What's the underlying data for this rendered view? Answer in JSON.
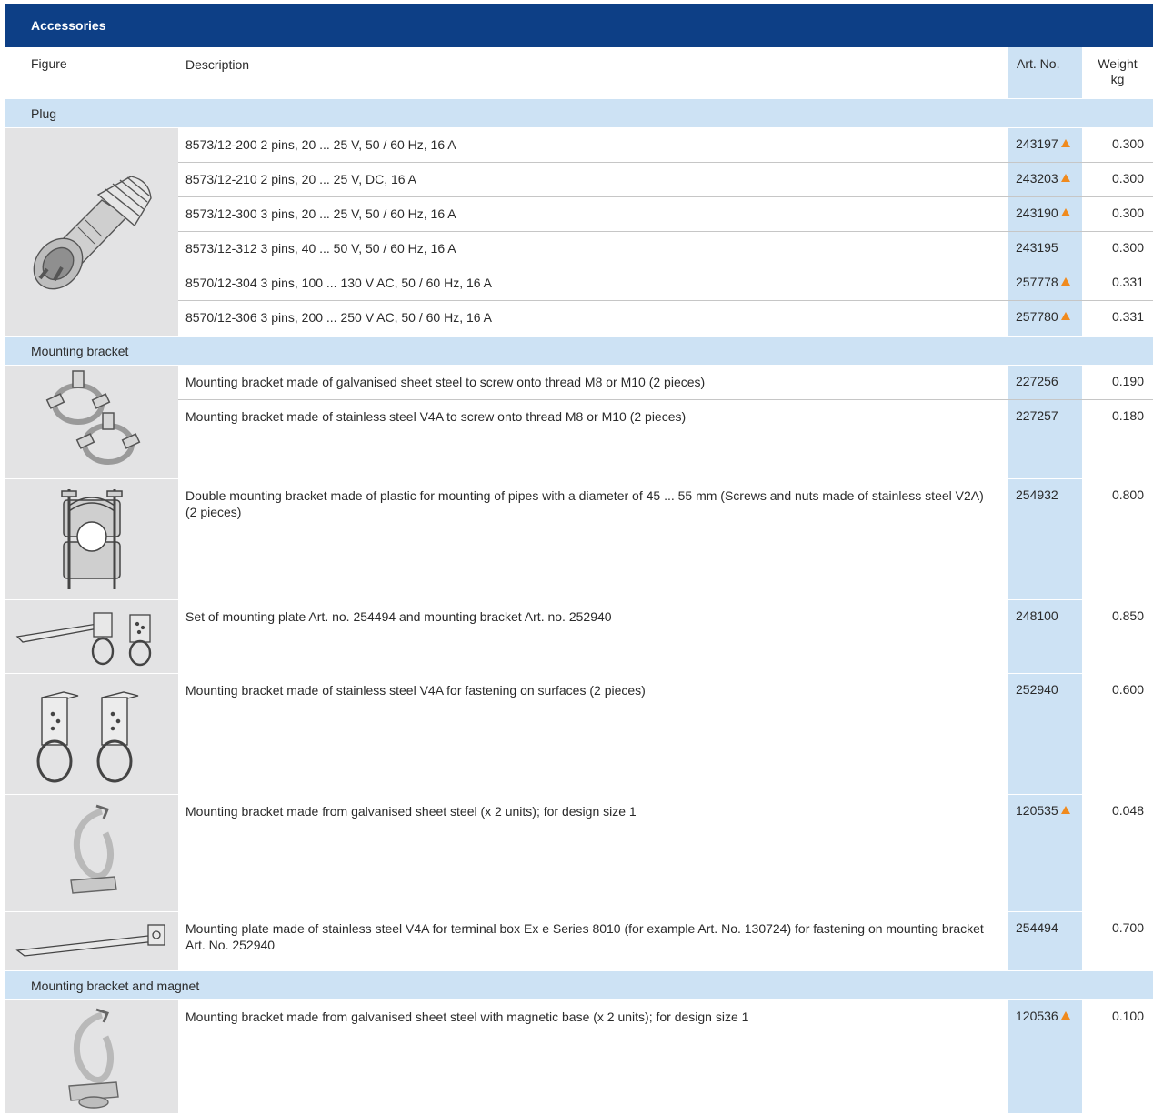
{
  "title": "Accessories",
  "columns": {
    "figure": "Figure",
    "description": "Description",
    "art_no": "Art. No.",
    "weight_line1": "Weight",
    "weight_line2": "kg"
  },
  "colors": {
    "header_bg": "#0d3f86",
    "category_bg": "#cde2f4",
    "figure_bg": "#e3e3e4",
    "art_col_bg": "#cde2f4",
    "marker": "#f08a1d"
  },
  "categories": [
    {
      "name": "Plug",
      "groups": [
        {
          "figure_icon": "plug-icon",
          "items": [
            {
              "desc": "8573/12-200 2 pins, 20 ... 25 V, 50 / 60 Hz, 16 A",
              "art": "243197",
              "marked": true,
              "weight": "0.300"
            },
            {
              "desc": "8573/12-210 2 pins, 20 ... 25 V, DC, 16 A",
              "art": "243203",
              "marked": true,
              "weight": "0.300"
            },
            {
              "desc": "8573/12-300 3 pins, 20 ... 25 V, 50 / 60 Hz, 16 A",
              "art": "243190",
              "marked": true,
              "weight": "0.300"
            },
            {
              "desc": "8573/12-312 3 pins, 40 ... 50 V, 50 / 60 Hz, 16 A",
              "art": "243195",
              "marked": false,
              "weight": "0.300"
            },
            {
              "desc": "8570/12-304 3 pins, 100 ... 130 V AC, 50 / 60 Hz, 16 A",
              "art": "257778",
              "marked": true,
              "weight": "0.331"
            },
            {
              "desc": "8570/12-306 3 pins, 200 ... 250 V AC, 50 / 60 Hz, 16 A",
              "art": "257780",
              "marked": true,
              "weight": "0.331"
            }
          ]
        }
      ]
    },
    {
      "name": "Mounting bracket",
      "groups": [
        {
          "figure_icon": "pipe-clamp-pair-icon",
          "items": [
            {
              "desc": "Mounting bracket made of galvanised sheet steel to screw onto thread M8 or M10 (2 pieces)",
              "art": "227256",
              "marked": false,
              "weight": "0.190"
            },
            {
              "desc": "Mounting bracket made of stainless steel V4A to screw onto thread M8 or M10 (2 pieces)",
              "art": "227257",
              "marked": false,
              "weight": "0.180"
            }
          ]
        },
        {
          "figure_icon": "double-bracket-icon",
          "items": [
            {
              "desc": "Double mounting bracket made of plastic for mounting of pipes with a diameter of 45 ... 55 mm (Screws and nuts made of stainless steel V2A) (2 pieces)",
              "art": "254932",
              "marked": false,
              "weight": "0.800"
            }
          ]
        },
        {
          "figure_icon": "plate-and-bracket-set-icon",
          "items": [
            {
              "desc": "Set of mounting plate Art. no. 254494 and mounting bracket Art. no. 252940",
              "art": "248100",
              "marked": false,
              "weight": "0.850"
            }
          ]
        },
        {
          "figure_icon": "surface-bracket-icon",
          "items": [
            {
              "desc": "Mounting bracket made of stainless steel V4A for fastening on surfaces (2 pieces)",
              "art": "252940",
              "marked": false,
              "weight": "0.600"
            }
          ]
        },
        {
          "figure_icon": "spring-clip-icon",
          "items": [
            {
              "desc": "Mounting bracket made from galvanised sheet steel (x 2 units); for design size 1",
              "art": "120535",
              "marked": true,
              "weight": "0.048"
            }
          ]
        },
        {
          "figure_icon": "mounting-plate-icon",
          "items": [
            {
              "desc": "Mounting plate made of stainless steel V4A for terminal box Ex e Series 8010 (for example Art. No. 130724) for fastening on mounting bracket Art. No. 252940",
              "art": "254494",
              "marked": false,
              "weight": "0.700"
            }
          ]
        }
      ]
    },
    {
      "name": "Mounting bracket and magnet",
      "groups": [
        {
          "figure_icon": "magnet-clip-icon",
          "items": [
            {
              "desc": "Mounting bracket made from galvanised sheet steel with magnetic base (x 2 units); for design size 1",
              "art": "120536",
              "marked": true,
              "weight": "0.100"
            }
          ]
        }
      ]
    }
  ]
}
